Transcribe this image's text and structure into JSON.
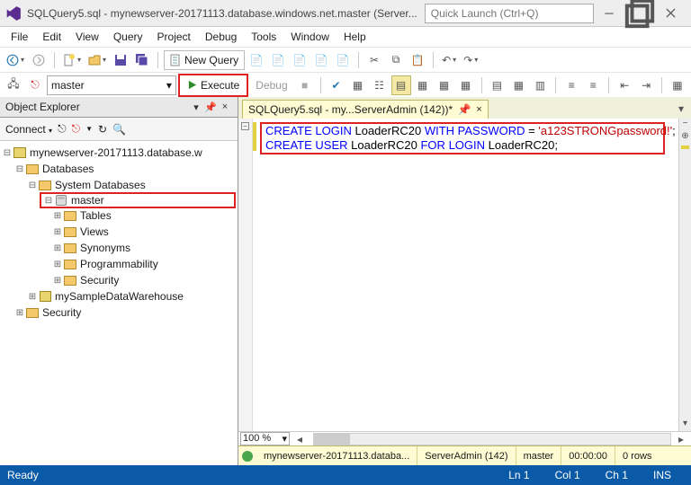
{
  "title": "SQLQuery5.sql - mynewserver-20171113.database.windows.net.master (Server...",
  "quicklaunch_placeholder": "Quick Launch (Ctrl+Q)",
  "menus": [
    "File",
    "Edit",
    "View",
    "Query",
    "Project",
    "Debug",
    "Tools",
    "Window",
    "Help"
  ],
  "toolbar1": {
    "new_query": "New Query"
  },
  "toolbar2": {
    "database": "master",
    "execute": "Execute",
    "debug": "Debug"
  },
  "object_explorer": {
    "title": "Object Explorer",
    "connect": "Connect",
    "tree": {
      "server": "mynewserver-20171113.database.w",
      "databases": "Databases",
      "system_db": "System Databases",
      "master": "master",
      "master_children": [
        "Tables",
        "Views",
        "Synonyms",
        "Programmability",
        "Security"
      ],
      "dw": "mySampleDataWarehouse",
      "top_security": "Security"
    }
  },
  "editor": {
    "tab": "SQLQuery5.sql - my...ServerAdmin (142))*",
    "code": {
      "l1a": "CREATE",
      "l1b": "LOGIN",
      "l1c": "LoaderRC20",
      "l1d": "WITH",
      "l1e": "PASSWORD",
      "l1eq": " = ",
      "l1f": "'a123STRONGpassword!'",
      "l1g": ";",
      "l2a": "CREATE",
      "l2b": "USER",
      "l2c": "LoaderRC20",
      "l2d": "FOR",
      "l2e": "LOGIN",
      "l2f": "LoaderRC20",
      "l2g": ";"
    },
    "zoom": "100 %"
  },
  "status_strip": {
    "server": "mynewserver-20171113.databa...",
    "user": "ServerAdmin (142)",
    "db": "master",
    "time": "00:00:00",
    "rows": "0 rows"
  },
  "statusbar": {
    "ready": "Ready",
    "ln": "Ln 1",
    "col": "Col 1",
    "ch": "Ch 1",
    "ins": "INS"
  }
}
